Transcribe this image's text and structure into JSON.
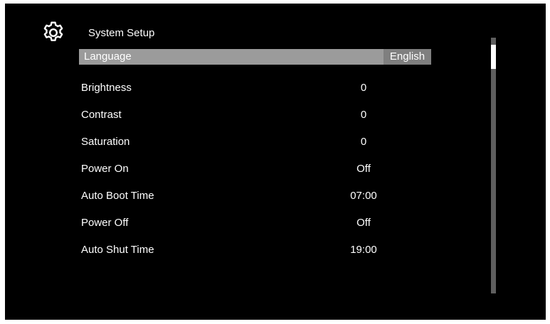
{
  "header": {
    "icon": "gear-icon",
    "title": "System Setup"
  },
  "menu": {
    "items": [
      {
        "label": "Language",
        "value": "English",
        "selected": true
      },
      {
        "label": "Brightness",
        "value": "0"
      },
      {
        "label": "Contrast",
        "value": "0"
      },
      {
        "label": "Saturation",
        "value": "0"
      },
      {
        "label": "Power On",
        "value": "Off"
      },
      {
        "label": "Auto Boot Time",
        "value": "07:00"
      },
      {
        "label": "Power Off",
        "value": "Off"
      },
      {
        "label": "Auto Shut Time",
        "value": "19:00"
      }
    ]
  },
  "colors": {
    "background": "#000000",
    "text": "#ffffff",
    "selection": "#9b9b9b",
    "selection_value": "#7f7f7f",
    "scroll_track": "#5f5f5f"
  },
  "scrollbar": {
    "position_fraction": 0.0
  }
}
